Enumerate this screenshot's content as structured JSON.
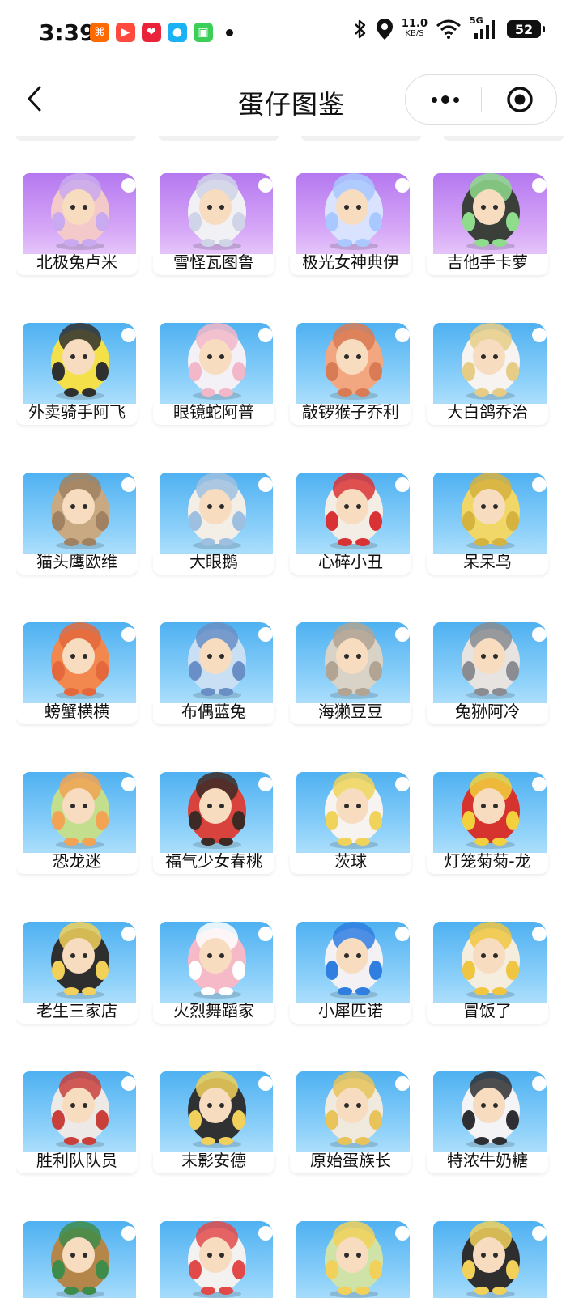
{
  "status_bar": {
    "time": "3:39",
    "app_icons": [
      {
        "name": "xiaohongshu-app-icon",
        "color": "#ff6a00",
        "glyph": "⌘"
      },
      {
        "name": "video-app-icon",
        "color": "#ff4a3d",
        "glyph": "▶"
      },
      {
        "name": "game-app-icon",
        "color": "#e8233a",
        "glyph": "❤"
      },
      {
        "name": "qq-app-icon",
        "color": "#1ab1f5",
        "glyph": "●"
      },
      {
        "name": "message-app-icon",
        "color": "#3ccf57",
        "glyph": "▣"
      }
    ],
    "net_speed": "11.0",
    "net_unit": "KB/S",
    "network": "5G",
    "battery": "52"
  },
  "header": {
    "title": "蛋仔图鉴"
  },
  "cards": [
    {
      "name": "北极兔卢米",
      "tier": "purple",
      "body": "#f4c9c9",
      "accent": "#c9a9ef"
    },
    {
      "name": "雪怪瓦图鲁",
      "tier": "purple",
      "body": "#f1f1f5",
      "accent": "#cfd4e6"
    },
    {
      "name": "极光女神典伊",
      "tier": "purple",
      "body": "#d9e3ff",
      "accent": "#a8c8ff"
    },
    {
      "name": "吉他手卡萝",
      "tier": "purple",
      "body": "#3a3f3a",
      "accent": "#8fdc8c"
    },
    {
      "name": "外卖骑手阿飞",
      "tier": "blue",
      "body": "#f4e14a",
      "accent": "#2f2f2f"
    },
    {
      "name": "眼镜蛇阿普",
      "tier": "blue",
      "body": "#f4f1f6",
      "accent": "#f2b7c8"
    },
    {
      "name": "敲锣猴子乔利",
      "tier": "blue",
      "body": "#f2a781",
      "accent": "#d97b54"
    },
    {
      "name": "大白鸽乔治",
      "tier": "blue",
      "body": "#f6f3f1",
      "accent": "#e7cc86"
    },
    {
      "name": "猫头鹰欧维",
      "tier": "blue",
      "body": "#c9a982",
      "accent": "#a08262"
    },
    {
      "name": "大眼鹅",
      "tier": "blue",
      "body": "#f3efe6",
      "accent": "#9fbfe0"
    },
    {
      "name": "心碎小丑",
      "tier": "blue",
      "body": "#f4ede6",
      "accent": "#d93234"
    },
    {
      "name": "呆呆鸟",
      "tier": "blue",
      "body": "#f0d768",
      "accent": "#d6b23f"
    },
    {
      "name": "螃蟹横横",
      "tier": "blue",
      "body": "#f2884d",
      "accent": "#e4683c"
    },
    {
      "name": "布偶蓝兔",
      "tier": "blue",
      "body": "#c9dff4",
      "accent": "#6a8fc6"
    },
    {
      "name": "海獭豆豆",
      "tier": "blue",
      "body": "#d9d2c6",
      "accent": "#b1a493"
    },
    {
      "name": "兔狲阿冷",
      "tier": "blue",
      "body": "#e7e3e0",
      "accent": "#8a8c91"
    },
    {
      "name": "恐龙迷",
      "tier": "blue",
      "body": "#c3df8e",
      "accent": "#f2a354"
    },
    {
      "name": "福气少女春桃",
      "tier": "blue",
      "body": "#d8433d",
      "accent": "#3d2a24"
    },
    {
      "name": "茨球",
      "tier": "blue",
      "body": "#f6f3f0",
      "accent": "#f0d35a"
    },
    {
      "name": "灯笼菊菊-龙",
      "tier": "blue",
      "body": "#d6322e",
      "accent": "#f2d13c"
    },
    {
      "name": "老生三家店",
      "tier": "blue",
      "body": "#2e2e2e",
      "accent": "#f2d15b"
    },
    {
      "name": "火烈舞蹈家",
      "tier": "blue",
      "body": "#f6b9c8",
      "accent": "#ffffff"
    },
    {
      "name": "小犀匹诺",
      "tier": "blue",
      "body": "#f3f1f4",
      "accent": "#2f7ee0"
    },
    {
      "name": "冒饭了",
      "tier": "blue",
      "body": "#f5eedf",
      "accent": "#f0c542"
    },
    {
      "name": "胜利队队员",
      "tier": "blue",
      "body": "#ece9e6",
      "accent": "#c9403b"
    },
    {
      "name": "末影安德",
      "tier": "blue",
      "body": "#2f3133",
      "accent": "#f1d15b"
    },
    {
      "name": "原始蛋族长",
      "tier": "blue",
      "body": "#efe9de",
      "accent": "#e7c35a"
    },
    {
      "name": "特浓牛奶糖",
      "tier": "blue",
      "body": "#f4f4f6",
      "accent": "#2f2f33"
    },
    {
      "name": "",
      "tier": "blue",
      "body": "#b5864a",
      "accent": "#3f8c4a"
    },
    {
      "name": "",
      "tier": "blue",
      "body": "#f4f2f1",
      "accent": "#e24a4a"
    },
    {
      "name": "",
      "tier": "blue",
      "body": "#cfe3a8",
      "accent": "#f2d15b"
    },
    {
      "name": "",
      "tier": "blue",
      "body": "#2e2e2e",
      "accent": "#f2d15b"
    }
  ]
}
